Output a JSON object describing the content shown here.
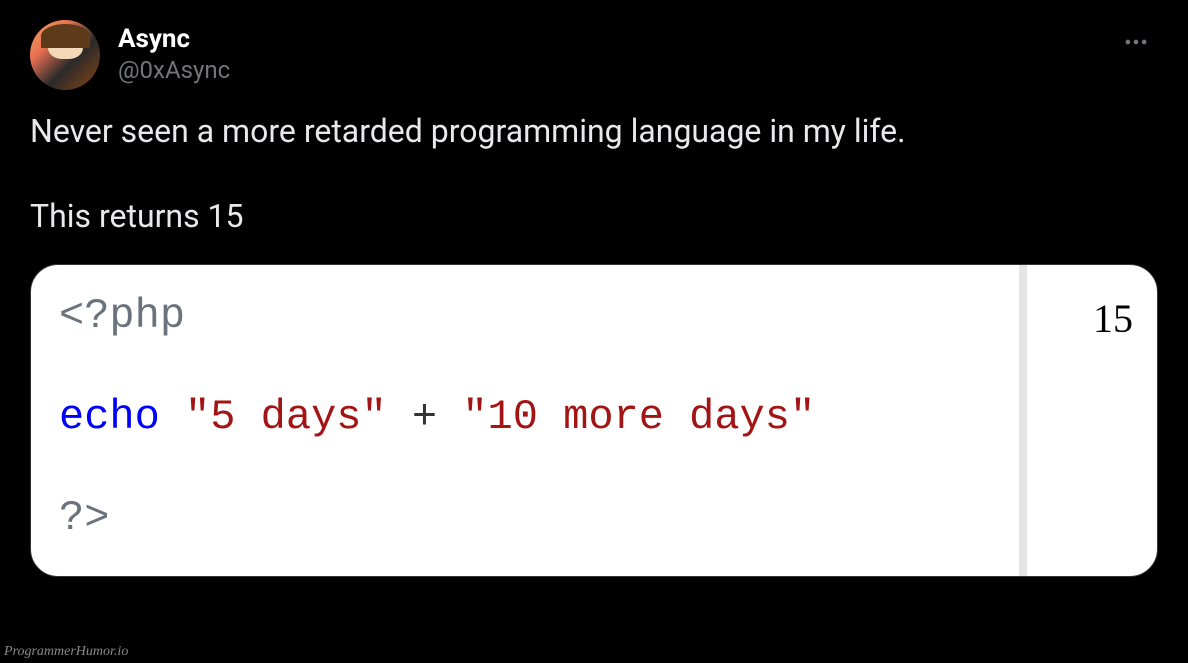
{
  "user": {
    "displayName": "Async",
    "handle": "@0xAsync"
  },
  "tweet": {
    "line1": "Never seen a more retarded programming language in my life.",
    "line2": "This returns 15"
  },
  "code": {
    "open": "<?php",
    "echo": "echo",
    "str1": "\"5 days\"",
    "plus": " + ",
    "str2": "\"10 more days\"",
    "close": "?>",
    "output": "15"
  },
  "watermark": "ProgrammerHumor.io"
}
